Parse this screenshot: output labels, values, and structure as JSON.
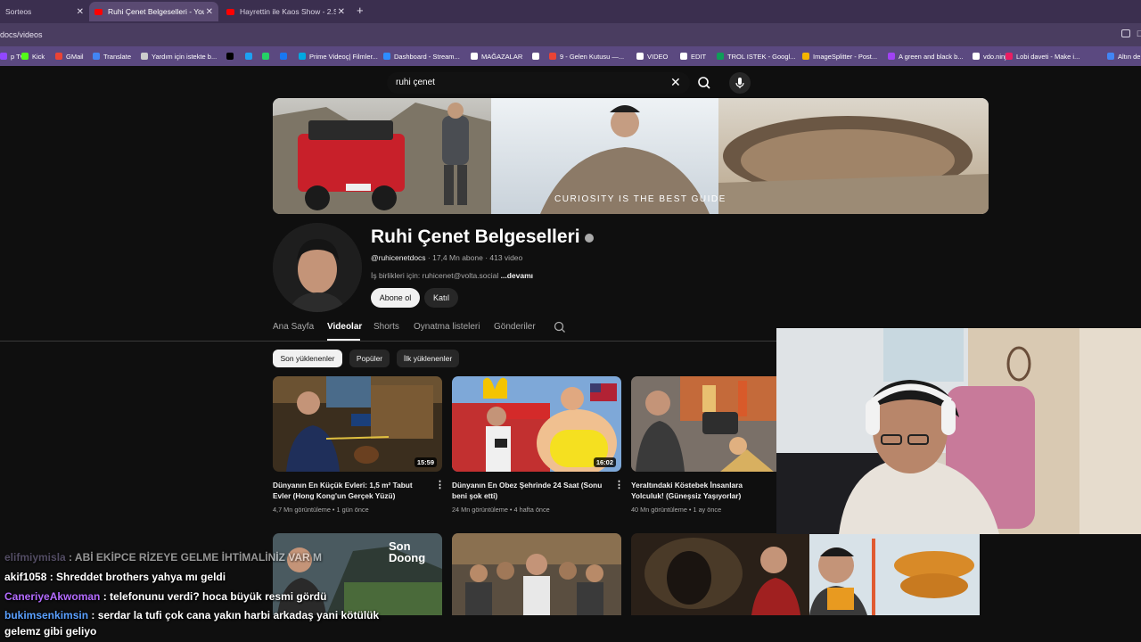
{
  "browser": {
    "tabs": [
      {
        "label": "Sorteos",
        "active": false
      },
      {
        "label": "Ruhi Çenet Belgeselleri - YouTube",
        "active": true
      },
      {
        "label": "Hayrettin ile Kaos Show - 2.Sez",
        "active": false
      }
    ],
    "url": "docs/videos",
    "bookmarks": [
      {
        "label": "p Tv",
        "color": "#9147ff"
      },
      {
        "label": "Kick",
        "color": "#53fc18"
      },
      {
        "label": "GMail",
        "color": "#ea4335"
      },
      {
        "label": "Translate",
        "color": "#4285f4"
      },
      {
        "label": "Yardım için istekte b...",
        "color": "#cccccc"
      },
      {
        "label": "",
        "color": "#000000"
      },
      {
        "label": "",
        "color": "#1da1f2"
      },
      {
        "label": "",
        "color": "#25d366"
      },
      {
        "label": "",
        "color": "#1877f2"
      },
      {
        "label": "Prime Videoç| Filmler...",
        "color": "#00a8e1"
      },
      {
        "label": "Dashboard - Stream...",
        "color": "#2d8cff"
      },
      {
        "label": "MAĞAZALAR",
        "color": "#ffffff"
      },
      {
        "label": "",
        "color": "#ffffff"
      },
      {
        "label": "9 - Gelen Kutusu —...",
        "color": "#ea4335"
      },
      {
        "label": "VIDEO",
        "color": "#ffffff"
      },
      {
        "label": "EDIT",
        "color": "#ffffff"
      },
      {
        "label": "TROL ISTEK - Googl...",
        "color": "#0f9d58"
      },
      {
        "label": "ImageSplitter - Post...",
        "color": "#f4b400"
      },
      {
        "label": "A green and black b...",
        "color": "#a142f4"
      },
      {
        "label": "vdo.ninja",
        "color": "#ffffff"
      },
      {
        "label": "Lobi daveti - Make i...",
        "color": "#e91e63"
      },
      {
        "label": "Altın de",
        "color": "#4285f4"
      }
    ]
  },
  "search": {
    "query": "ruhi çenet"
  },
  "channel": {
    "banner_tagline": "CURIOSITY IS THE BEST GUIDE",
    "name": "Ruhi Çenet Belgeselleri",
    "handle": "@ruhicenetdocs",
    "stats": " · 17,4 Mn abone · 413 video",
    "description": "İş birlikleri için: ruhicenet@volta.social ",
    "more": "...devamı",
    "subscribe_label": "Abone ol",
    "join_label": "Katıl"
  },
  "channel_tabs": [
    "Ana Sayfa",
    "Videolar",
    "Shorts",
    "Oynatma listeleri",
    "Gönderiler"
  ],
  "active_channel_tab": "Videolar",
  "chips": [
    "Son yüklenenler",
    "Popüler",
    "İlk yüklenenler"
  ],
  "videos": [
    {
      "title": "Dünyanın En Küçük Evleri: 1,5 m² Tabut Evler (Hong Kong'un Gerçek Yüzü)",
      "duration": "15:59",
      "views": "4,7 Mn görüntüleme",
      "age": "1 gün önce"
    },
    {
      "title": "Dünyanın En Obez Şehrinde 24 Saat (Sonu beni şok etti)",
      "duration": "16:02",
      "views": "24 Mn görüntüleme",
      "age": "4 hafta önce"
    },
    {
      "title": "Yeraltındaki Köstebek İnsanlara Yolculuk! (Güneşsiz Yaşıyorlar)",
      "duration": "",
      "views": "40 Mn görüntüleme",
      "age": "1 ay önce"
    }
  ],
  "row2_thumb_text": "Son Doong",
  "chat": [
    {
      "user": "elifmiymisla",
      "user_color": "#8a7fa8",
      "text": "ABİ EKİPCE RİZEYE GELME İHTİMALİNİZ VAR M"
    },
    {
      "user": "akif1058",
      "user_color": "#ffffff",
      "text": "Shreddet brothers yahya mı geldi"
    },
    {
      "user": "CaneriyeAkwoman",
      "user_color": "#b46cff",
      "text": "telefonunu verdi? hoca büyük resmi gördü"
    },
    {
      "user": "bukimsenkimsin",
      "user_color": "#5aa0ff",
      "text": "serdar la tufi çok cana yakın harbi arkadaş yani kötülük"
    },
    {
      "user": "",
      "user_color": "#ffffff",
      "text": "gelemz gibi geliyo"
    }
  ]
}
